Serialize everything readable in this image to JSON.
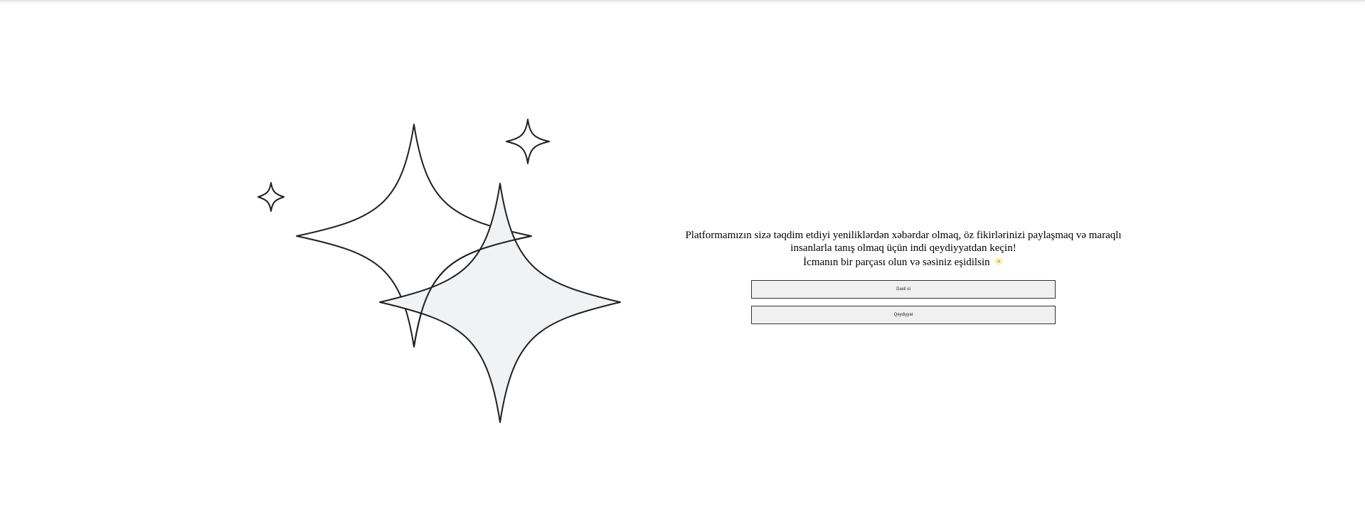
{
  "welcome": {
    "intro": "Platformamızın sizə təqdim etdiyi yeniliklərdən xəbərdar olmaq, öz fikirlərinizi paylaşmaq və maraqlı insanlarla tanış olmaq üçün indi qeydiyyatdan keçin!",
    "tagline": "İcmanın bir parçası olun və səsiniz eşidilsin",
    "tagline_emoji": "☀",
    "login_button": "Daxil ol",
    "signup_button": "Qeydiyyat"
  },
  "illustration": {
    "icon": "sparkles-icon",
    "fill_color": "#f1f2f4",
    "stroke_color": "#1f1f1f"
  }
}
